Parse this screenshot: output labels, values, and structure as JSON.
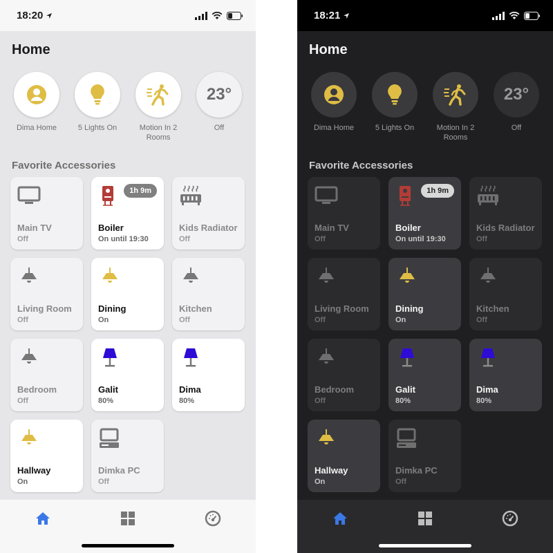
{
  "colors": {
    "accent": "#3b78e7",
    "light_on": "#dfbd45",
    "light_off": "#777777",
    "purple_lamp": "#2f0bd6",
    "boiler_red": "#b43c37"
  },
  "screens": [
    {
      "theme": "light",
      "time": "18:20",
      "title": "Home",
      "summary": [
        {
          "label": "Dima Home",
          "icon": "person-circle-icon"
        },
        {
          "label": "5 Lights On",
          "icon": "lightbulb-icon"
        },
        {
          "label": "Motion In 2 Rooms",
          "icon": "person-running-icon"
        },
        {
          "label": "Off",
          "value": "23°",
          "icon": "thermostat"
        }
      ],
      "section_title": "Favorite Accessories",
      "tiles": [
        {
          "name": "Main TV",
          "state": "Off",
          "on": false,
          "icon": "tv"
        },
        {
          "name": "Boiler",
          "state": "On until 19:30",
          "on": true,
          "icon": "boiler",
          "badge": "1h 9m"
        },
        {
          "name": "Kids Radiator",
          "state": "Off",
          "on": false,
          "icon": "radiator"
        },
        {
          "name": "Living Room",
          "state": "Off",
          "on": false,
          "icon": "pendant"
        },
        {
          "name": "Dining",
          "state": "On",
          "on": true,
          "icon": "pendant"
        },
        {
          "name": "Kitchen",
          "state": "Off",
          "on": false,
          "icon": "pendant"
        },
        {
          "name": "Bedroom",
          "state": "Off",
          "on": false,
          "icon": "pendant"
        },
        {
          "name": "Galit",
          "state": "80%",
          "on": true,
          "icon": "lamp"
        },
        {
          "name": "Dima",
          "state": "80%",
          "on": true,
          "icon": "lamp"
        },
        {
          "name": "Hallway",
          "state": "On",
          "on": true,
          "icon": "pendant"
        },
        {
          "name": "Dimka PC",
          "state": "Off",
          "on": false,
          "icon": "pc"
        }
      ],
      "tabs": [
        {
          "icon": "home-icon",
          "active": true
        },
        {
          "icon": "grid-icon",
          "active": false
        },
        {
          "icon": "dashboard-icon",
          "active": false
        }
      ]
    },
    {
      "theme": "dark",
      "time": "18:21",
      "title": "Home",
      "summary": [
        {
          "label": "Dima Home",
          "icon": "person-circle-icon"
        },
        {
          "label": "5 Lights On",
          "icon": "lightbulb-icon"
        },
        {
          "label": "Motion In 2 Rooms",
          "icon": "person-running-icon"
        },
        {
          "label": "Off",
          "value": "23°",
          "icon": "thermostat"
        }
      ],
      "section_title": "Favorite Accessories",
      "tiles": [
        {
          "name": "Main TV",
          "state": "Off",
          "on": false,
          "icon": "tv"
        },
        {
          "name": "Boiler",
          "state": "On until 19:30",
          "on": true,
          "icon": "boiler",
          "badge": "1h 9m"
        },
        {
          "name": "Kids Radiator",
          "state": "Off",
          "on": false,
          "icon": "radiator"
        },
        {
          "name": "Living Room",
          "state": "Off",
          "on": false,
          "icon": "pendant"
        },
        {
          "name": "Dining",
          "state": "On",
          "on": true,
          "icon": "pendant"
        },
        {
          "name": "Kitchen",
          "state": "Off",
          "on": false,
          "icon": "pendant"
        },
        {
          "name": "Bedroom",
          "state": "Off",
          "on": false,
          "icon": "pendant"
        },
        {
          "name": "Galit",
          "state": "80%",
          "on": true,
          "icon": "lamp"
        },
        {
          "name": "Dima",
          "state": "80%",
          "on": true,
          "icon": "lamp"
        },
        {
          "name": "Hallway",
          "state": "On",
          "on": true,
          "icon": "pendant"
        },
        {
          "name": "Dimka PC",
          "state": "Off",
          "on": false,
          "icon": "pc"
        }
      ],
      "tabs": [
        {
          "icon": "home-icon",
          "active": true
        },
        {
          "icon": "grid-icon",
          "active": false
        },
        {
          "icon": "dashboard-icon",
          "active": false
        }
      ]
    }
  ]
}
